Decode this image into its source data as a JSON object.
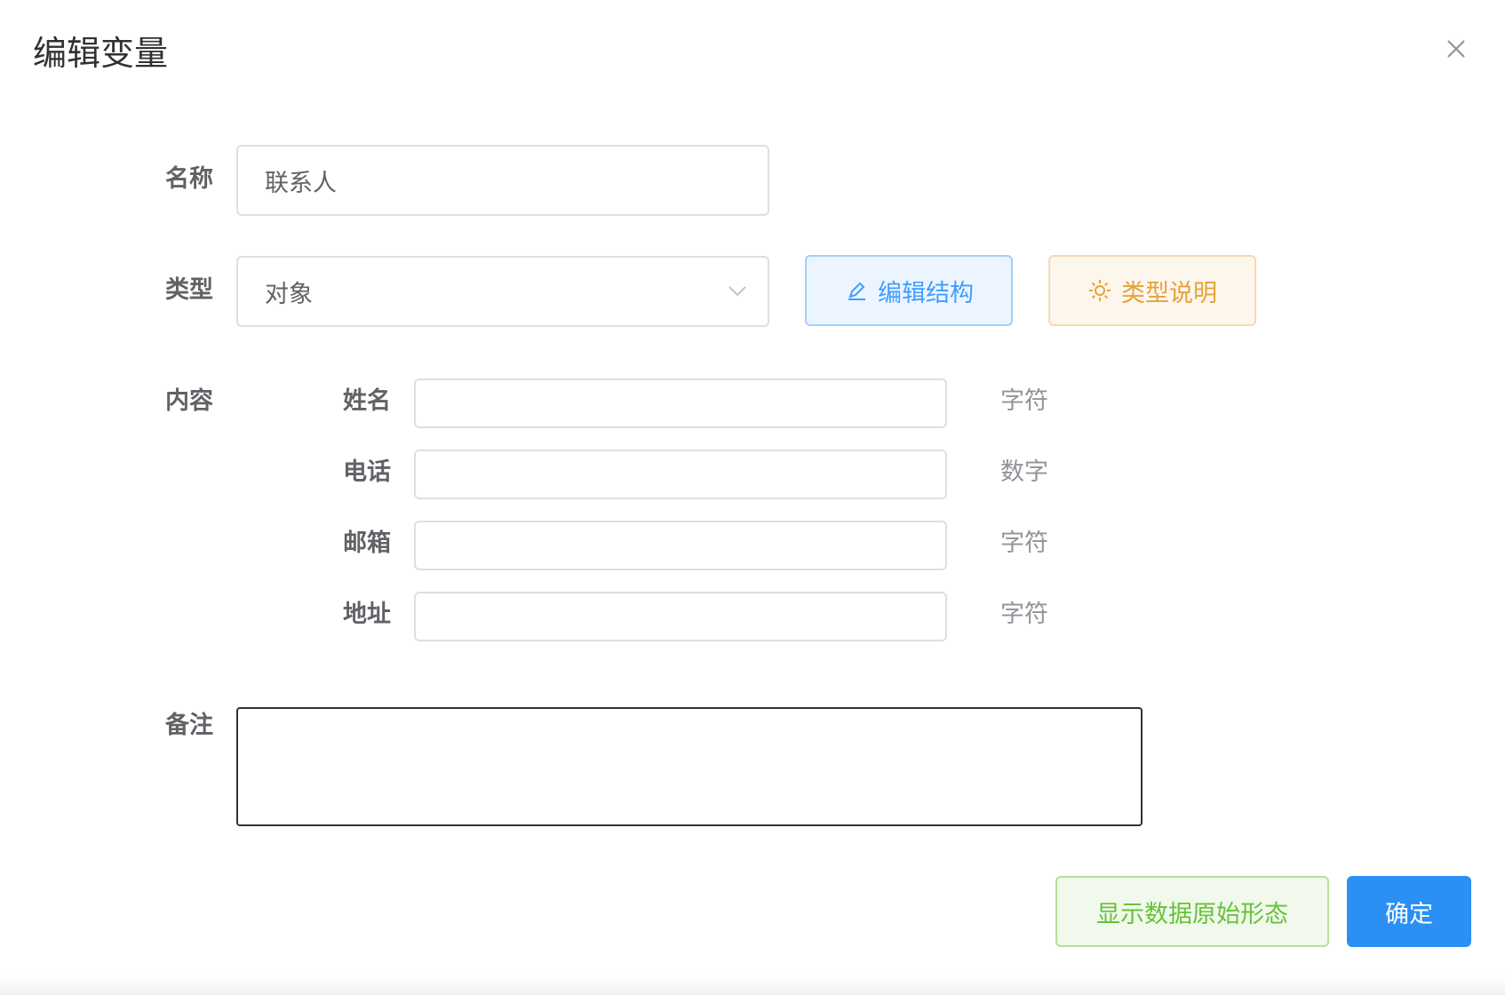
{
  "dialog": {
    "title": "编辑变量"
  },
  "form": {
    "name_label": "名称",
    "name_value": "联系人",
    "type_label": "类型",
    "type_value": "对象",
    "edit_structure_label": "编辑结构",
    "type_help_label": "类型说明",
    "content_label": "内容",
    "fields": [
      {
        "label": "姓名",
        "value": "",
        "type": "字符"
      },
      {
        "label": "电话",
        "value": "",
        "type": "数字"
      },
      {
        "label": "邮箱",
        "value": "",
        "type": "字符"
      },
      {
        "label": "地址",
        "value": "",
        "type": "字符"
      }
    ],
    "remark_label": "备注",
    "remark_value": ""
  },
  "footer": {
    "show_raw_label": "显示数据原始形态",
    "confirm_label": "确定"
  },
  "colors": {
    "primary": "#409eff",
    "warning": "#e6a23c",
    "success": "#67c23a",
    "confirm_bg": "#2b90f3"
  },
  "icons": {
    "close": "close-icon",
    "chevron": "chevron-down-icon",
    "edit": "edit-icon",
    "help": "sun-icon"
  }
}
